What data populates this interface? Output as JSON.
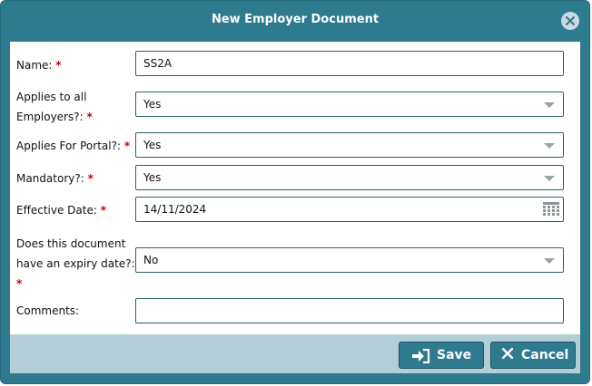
{
  "dialog": {
    "title": "New Employer Document",
    "close_icon": "close-icon"
  },
  "form": {
    "required_mark": "*",
    "name": {
      "label": "Name:",
      "value": "SS2A"
    },
    "applies_all": {
      "label_line1": "Applies to all",
      "label_line2": "Employers?:",
      "value": "Yes"
    },
    "applies_portal": {
      "label": "Applies For Portal?:",
      "value": "Yes"
    },
    "mandatory": {
      "label": "Mandatory?:",
      "value": "Yes"
    },
    "effective_date": {
      "label": "Effective Date:",
      "value": "14/11/2024",
      "icon": "calendar-icon"
    },
    "expiry": {
      "label_line1": "Does this document",
      "label_line2": "have an expiry date?:",
      "value": "No"
    },
    "comments": {
      "label": "Comments:",
      "value": ""
    }
  },
  "footer": {
    "save_label": "Save",
    "save_icon": "sign-in-icon",
    "cancel_label": "Cancel",
    "cancel_icon": "x-icon"
  },
  "colors": {
    "header": "#2e7a8e",
    "footer": "#b3ced6",
    "required": "#cc0000"
  }
}
